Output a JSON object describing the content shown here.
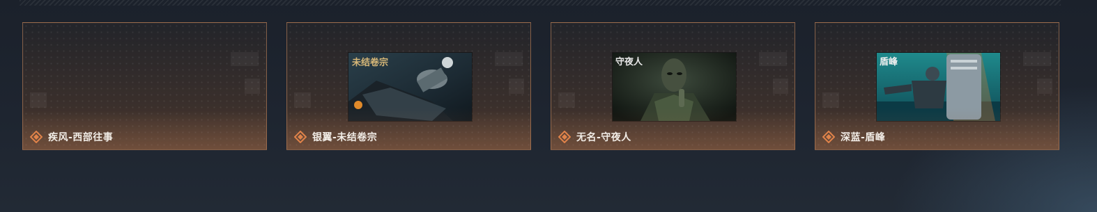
{
  "colors": {
    "accent": "#e0834a",
    "card_border": "#c98c60",
    "label_text": "#f1ece6",
    "background": "#1e2530"
  },
  "cards": [
    {
      "title": "疾风-西部往事",
      "icon": "diamond-icon",
      "has_image": false
    },
    {
      "title": "银翼-未结卷宗",
      "icon": "diamond-icon",
      "has_image": true,
      "image_caption": "未结卷宗"
    },
    {
      "title": "无名-守夜人",
      "icon": "diamond-icon",
      "has_image": true,
      "image_caption": "守夜人"
    },
    {
      "title": "深蓝-盾峰",
      "icon": "diamond-icon",
      "has_image": true,
      "image_caption": "盾峰"
    }
  ]
}
